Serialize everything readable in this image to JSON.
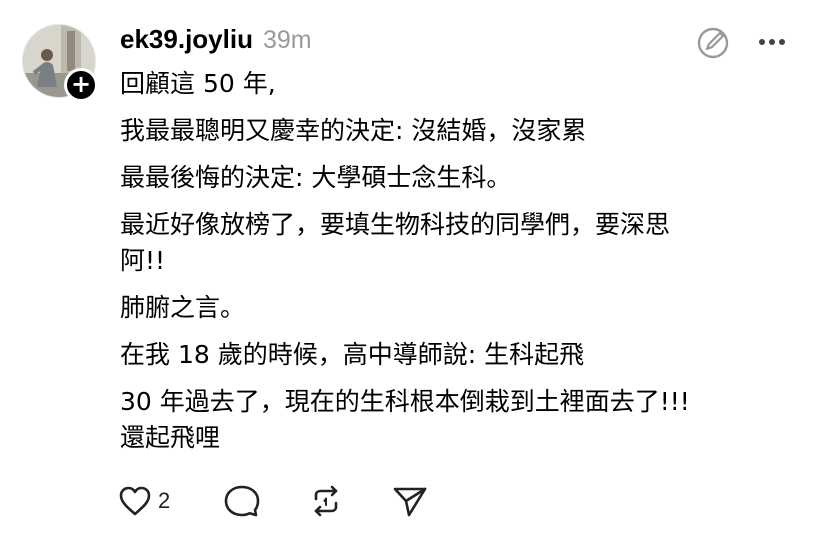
{
  "post": {
    "username": "ek39.joyliu",
    "timestamp": "39m",
    "lines": [
      "回顧這 50 年,",
      "我最最聰明又慶幸的決定: 沒結婚，沒家累",
      "最最後悔的決定: 大學碩士念生科。",
      "最近好像放榜了，要填生物科技的同學們，要深思",
      "阿!!",
      "肺腑之言。",
      "在我 18 歲的時候，高中導師說: 生科起飛",
      "30 年過去了，現在的生科根本倒栽到土裡面去了!!!",
      "還起飛哩"
    ]
  },
  "actions": {
    "like_count": "2"
  },
  "icons": [
    "avatar",
    "follow-plus-icon",
    "edit-icon",
    "more-icon",
    "heart-icon",
    "comment-icon",
    "repost-icon",
    "share-icon"
  ]
}
